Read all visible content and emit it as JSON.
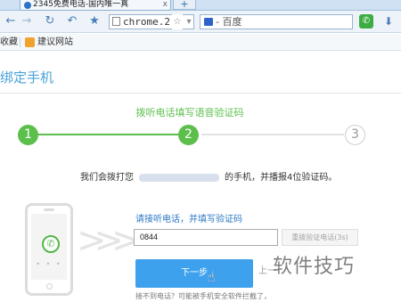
{
  "browser": {
    "tab_title": "2345免费电话-国内唯一真",
    "tab_close": "x",
    "new_tab": "+",
    "url": "chrome.2",
    "search_placeholder": "- 百度",
    "phone_btn_icon": "phone-icon",
    "download_icon": "download-icon"
  },
  "bookmarks": {
    "favorites_label": "收藏",
    "suggested_site": "建议网站"
  },
  "page": {
    "title": "绑定手机",
    "step_caption": "拨听电话填写语音验证码",
    "steps": [
      "1",
      "2",
      "3"
    ],
    "active_step": 2,
    "dial_prefix": "我们会拨打您",
    "dial_suffix": "的手机，并播报4位验证码。",
    "verify_label": "请接听电话，并填写验证码",
    "code_value": "0844",
    "resend_label": "重拨验证电话(3s)",
    "next_label": "下一步",
    "prev_label": "上一",
    "help_text": "接不到电话？可能被手机安全软件拦截了，",
    "watermark": "软件技巧"
  },
  "colors": {
    "accent_green": "#5cbf4c",
    "button_blue": "#3ea1ee",
    "title_blue": "#4aa3d8"
  }
}
